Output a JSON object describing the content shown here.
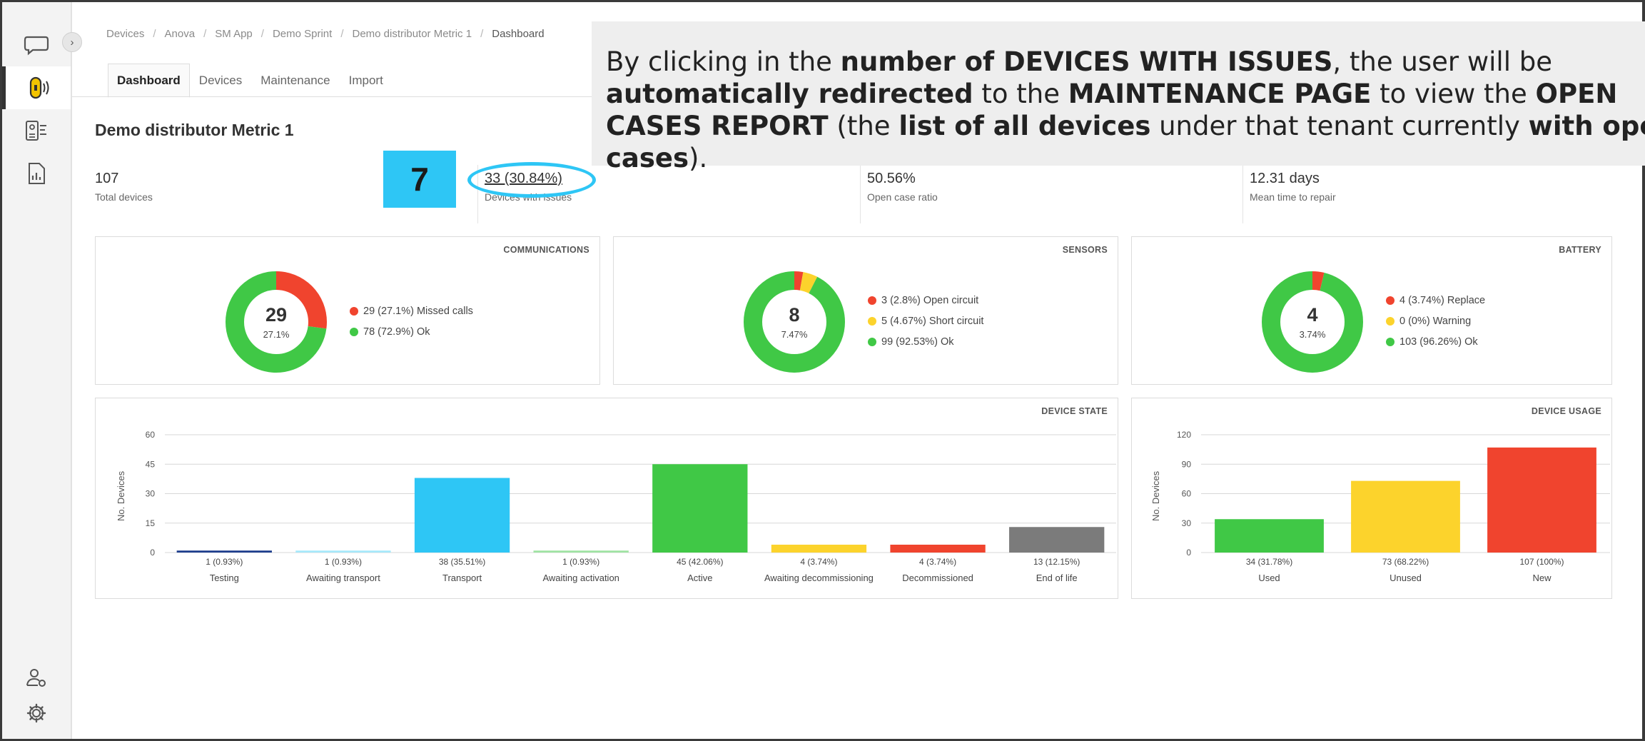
{
  "breadcrumb": [
    "Devices",
    "Anova",
    "SM App",
    "Demo Sprint",
    "Demo distributor Metric 1",
    "Dashboard"
  ],
  "tabs": [
    "Dashboard",
    "Devices",
    "Maintenance",
    "Import"
  ],
  "page_title": "Demo distributor Metric 1",
  "kpis": {
    "total": {
      "value": "107",
      "label": "Total devices"
    },
    "issues": {
      "value": "33 (30.84%)",
      "label": "Devices with issues"
    },
    "open_ratio": {
      "value": "50.56%",
      "label": "Open case ratio"
    },
    "mttr": {
      "value": "12.31 days",
      "label": "Mean time to repair"
    }
  },
  "step_badge": "7",
  "callout": {
    "parts": [
      {
        "t": "By clicking in the ",
        "b": false
      },
      {
        "t": "number of DEVICES WITH ISSUES",
        "b": true
      },
      {
        "t": ", the user will be ",
        "b": false
      },
      {
        "t": "automatically redirected",
        "b": true
      },
      {
        "t": " to the ",
        "b": false
      },
      {
        "t": "MAINTENANCE PAGE",
        "b": true
      },
      {
        "t": " to view the ",
        "b": false
      },
      {
        "t": "OPEN CASES REPORT",
        "b": true
      },
      {
        "t": " (the ",
        "b": false
      },
      {
        "t": "list of all devices",
        "b": true
      },
      {
        "t": " under that tenant currently ",
        "b": false
      },
      {
        "t": "with open cases",
        "b": true
      },
      {
        "t": ").",
        "b": false
      }
    ]
  },
  "colors": {
    "red": "#f0442e",
    "green": "#40c846",
    "yellow": "#fcd32c",
    "cyan": "#2ec6f5",
    "navy": "#1c3c8c",
    "lightcyan": "#a6e8fa",
    "lightgreen": "#9fe3a2",
    "gray": "#7b7b7b"
  },
  "icons": {
    "rail": [
      "chat-bubble-icon",
      "device-signal-icon",
      "device-list-icon",
      "report-icon",
      "user-settings-icon",
      "gear-icon"
    ],
    "toggle": "chevron-right-icon"
  },
  "donuts": {
    "communications": {
      "title": "COMMUNICATIONS",
      "center": "29",
      "center_pct": "27.1%",
      "segments": [
        {
          "label": "29 (27.1%) Missed calls",
          "value": 29,
          "color": "#f0442e"
        },
        {
          "label": "78 (72.9%) Ok",
          "value": 78,
          "color": "#40c846"
        }
      ]
    },
    "sensors": {
      "title": "SENSORS",
      "center": "8",
      "center_pct": "7.47%",
      "segments": [
        {
          "label": "3 (2.8%) Open circuit",
          "value": 3,
          "color": "#f0442e"
        },
        {
          "label": "5 (4.67%) Short circuit",
          "value": 5,
          "color": "#fcd32c"
        },
        {
          "label": "99 (92.53%) Ok",
          "value": 99,
          "color": "#40c846"
        }
      ]
    },
    "battery": {
      "title": "BATTERY",
      "center": "4",
      "center_pct": "3.74%",
      "segments": [
        {
          "label": "4 (3.74%) Replace",
          "value": 4,
          "color": "#f0442e"
        },
        {
          "label": "0 (0%) Warning",
          "value": 0,
          "color": "#fcd32c"
        },
        {
          "label": "103 (96.26%) Ok",
          "value": 103,
          "color": "#40c846"
        }
      ]
    }
  },
  "chart_data": [
    {
      "type": "bar",
      "title": "DEVICE STATE",
      "ylabel": "No. Devices",
      "ylim": [
        0,
        60
      ],
      "yticks": [
        0,
        15,
        30,
        45,
        60
      ],
      "grid": true,
      "categories": [
        "Testing",
        "Awaiting transport",
        "Transport",
        "Awaiting activation",
        "Active",
        "Awaiting decommissioning",
        "Decommissioned",
        "End of life"
      ],
      "values": [
        1,
        1,
        38,
        1,
        45,
        4,
        4,
        13
      ],
      "value_labels": [
        "1 (0.93%)",
        "1 (0.93%)",
        "38 (35.51%)",
        "1 (0.93%)",
        "45 (42.06%)",
        "4 (3.74%)",
        "4 (3.74%)",
        "13 (12.15%)"
      ],
      "colors": [
        "#1c3c8c",
        "#a6e8fa",
        "#2ec6f5",
        "#9fe3a2",
        "#40c846",
        "#fcd32c",
        "#f0442e",
        "#7b7b7b"
      ]
    },
    {
      "type": "bar",
      "title": "DEVICE USAGE",
      "ylabel": "No. Devices",
      "ylim": [
        0,
        120
      ],
      "yticks": [
        0,
        30,
        60,
        90,
        120
      ],
      "grid": true,
      "categories": [
        "Used",
        "Unused",
        "New"
      ],
      "values": [
        34,
        73,
        107
      ],
      "value_labels": [
        "34 (31.78%)",
        "73 (68.22%)",
        "107 (100%)"
      ],
      "colors": [
        "#40c846",
        "#fcd32c",
        "#f0442e"
      ]
    }
  ]
}
